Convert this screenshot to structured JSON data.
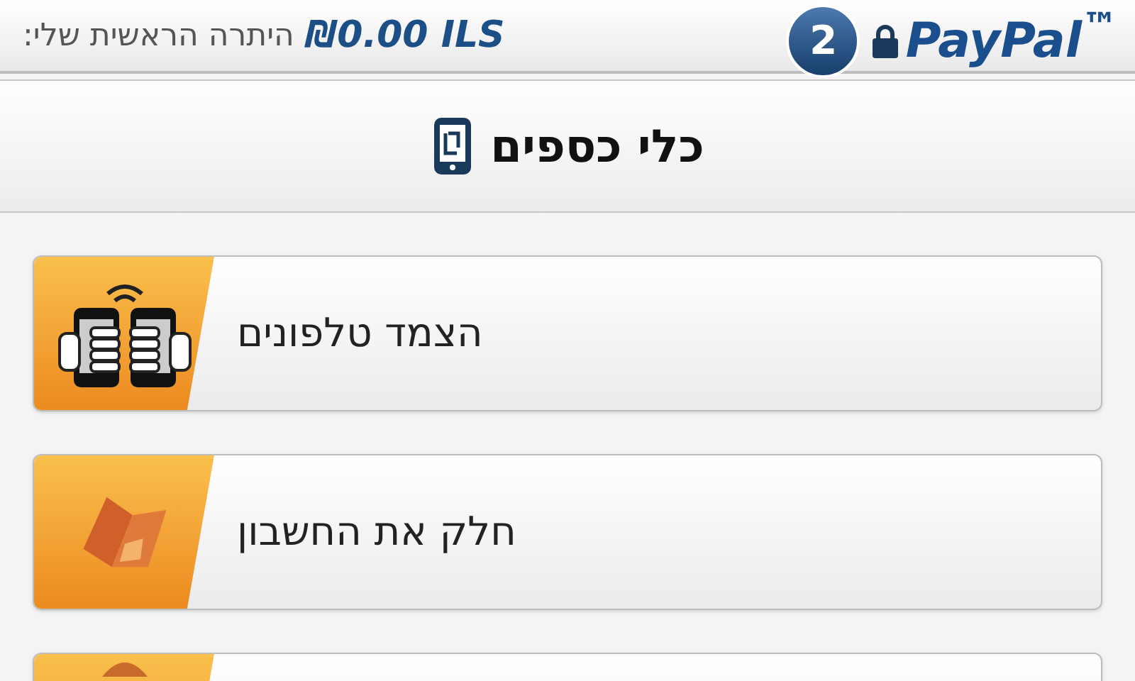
{
  "header": {
    "balance_label": "היתרה הראשית שלי:",
    "balance": "₪0.00 ILS",
    "badge": "2",
    "logo": "PayPal$^{™}$"
  },
  "title": "כלי כספים",
  "items": [
    {
      "kind": "phones",
      "label": "הצמד טלפונים"
    },
    {
      "kind": "bill",
      "label": "חלק את החשבון"
    },
    {
      "kind": "other"
    }
  ]
}
